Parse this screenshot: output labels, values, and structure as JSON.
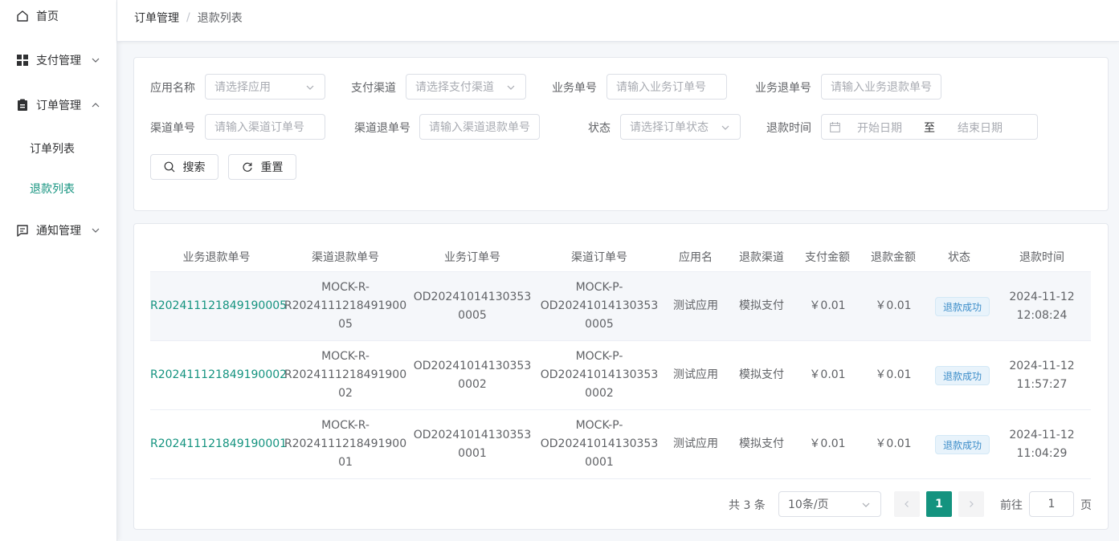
{
  "sidebar": {
    "items": [
      {
        "label": "首页",
        "icon": "home-icon"
      },
      {
        "label": "支付管理",
        "icon": "grid-icon"
      },
      {
        "label": "订单管理",
        "icon": "clipboard-icon"
      },
      {
        "label": "通知管理",
        "icon": "message-icon"
      }
    ],
    "sub_items": [
      {
        "label": "订单列表"
      },
      {
        "label": "退款列表",
        "active": true
      }
    ]
  },
  "breadcrumb": {
    "parent": "订单管理",
    "separator": "/",
    "current": "退款列表"
  },
  "filters": {
    "app_name": {
      "label": "应用名称",
      "placeholder": "请选择应用"
    },
    "pay_channel": {
      "label": "支付渠道",
      "placeholder": "请选择支付渠道"
    },
    "biz_order_no": {
      "label": "业务单号",
      "placeholder": "请输入业务订单号"
    },
    "biz_refund_no": {
      "label": "业务退单号",
      "placeholder": "请输入业务退款单号"
    },
    "channel_order_no": {
      "label": "渠道单号",
      "placeholder": "请输入渠道订单号"
    },
    "channel_refund_no": {
      "label": "渠道退单号",
      "placeholder": "请输入渠道退款单号"
    },
    "status": {
      "label": "状态",
      "placeholder": "请选择订单状态"
    },
    "refund_time": {
      "label": "退款时间",
      "start_placeholder": "开始日期",
      "range_separator": "至",
      "end_placeholder": "结束日期"
    },
    "search_label": "搜索",
    "reset_label": "重置"
  },
  "table": {
    "columns": [
      "业务退款单号",
      "渠道退款单号",
      "业务订单号",
      "渠道订单号",
      "应用名",
      "退款渠道",
      "支付金额",
      "退款金额",
      "状态",
      "退款时间"
    ],
    "rows": [
      {
        "refund_no": "R202411121849190005",
        "channel_refund": [
          "MOCK-R-",
          "R2024111218491900",
          "05"
        ],
        "order_no": [
          "OD20241014130353",
          "0005"
        ],
        "channel_order": [
          "MOCK-P-",
          "OD20241014130353",
          "0005"
        ],
        "app": "测试应用",
        "channel": "模拟支付",
        "pay_amount": "￥0.01",
        "refund_amount": "￥0.01",
        "status": "退款成功",
        "time": [
          "2024-11-12",
          "12:08:24"
        ]
      },
      {
        "refund_no": "R202411121849190002",
        "channel_refund": [
          "MOCK-R-",
          "R2024111218491900",
          "02"
        ],
        "order_no": [
          "OD20241014130353",
          "0002"
        ],
        "channel_order": [
          "MOCK-P-",
          "OD20241014130353",
          "0002"
        ],
        "app": "测试应用",
        "channel": "模拟支付",
        "pay_amount": "￥0.01",
        "refund_amount": "￥0.01",
        "status": "退款成功",
        "time": [
          "2024-11-12",
          "11:57:27"
        ]
      },
      {
        "refund_no": "R202411121849190001",
        "channel_refund": [
          "MOCK-R-",
          "R2024111218491900",
          "01"
        ],
        "order_no": [
          "OD20241014130353",
          "0001"
        ],
        "channel_order": [
          "MOCK-P-",
          "OD20241014130353",
          "0001"
        ],
        "app": "测试应用",
        "channel": "模拟支付",
        "pay_amount": "￥0.01",
        "refund_amount": "￥0.01",
        "status": "退款成功",
        "time": [
          "2024-11-12",
          "11:04:29"
        ]
      }
    ]
  },
  "pagination": {
    "total_text": "共 3 条",
    "page_size": "10条/页",
    "current_page": "1",
    "goto_label": "前往",
    "goto_value": "1",
    "page_suffix": "页"
  },
  "colors": {
    "accent": "#14937f",
    "tag_text": "#3c8dc9",
    "tag_bg": "#e8f3fb"
  }
}
